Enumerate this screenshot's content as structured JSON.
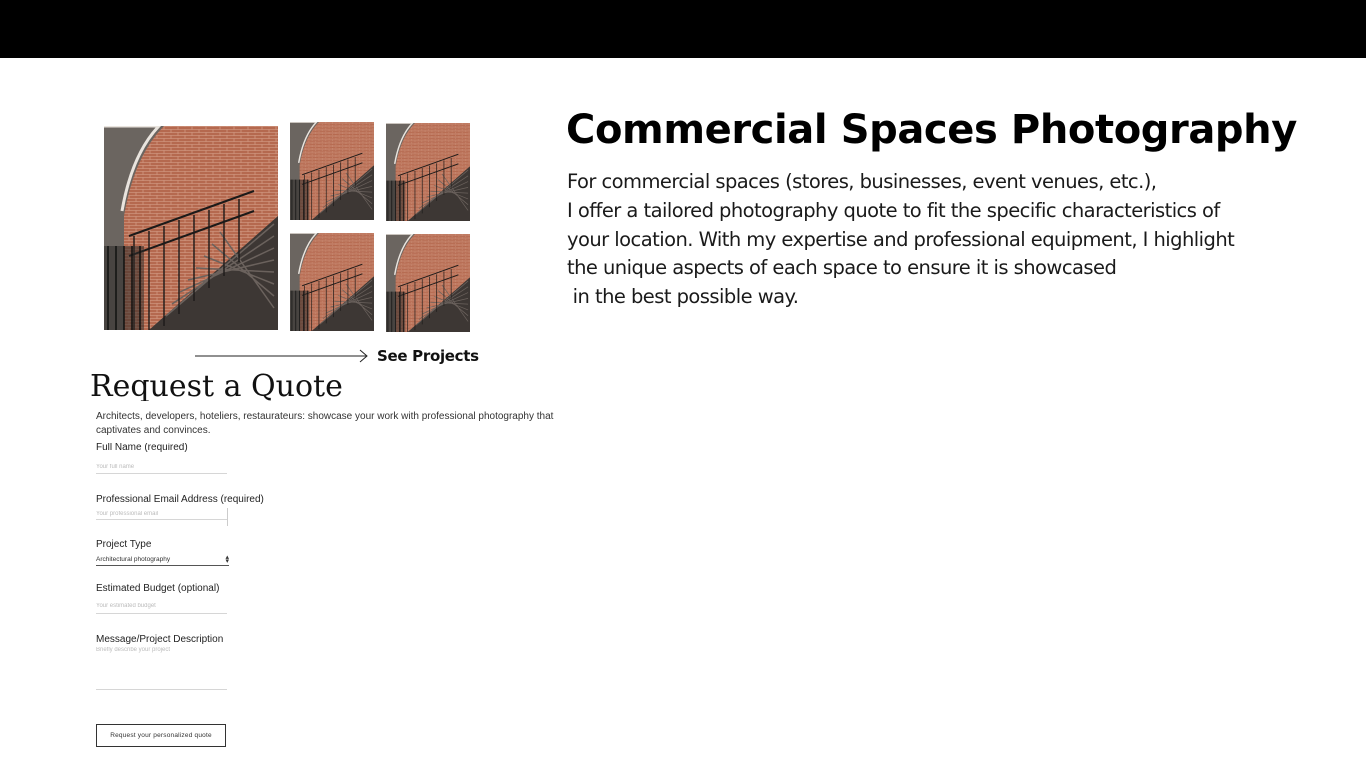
{
  "header": {},
  "hero": {
    "title": "Commercial Spaces Photography",
    "description": "For commercial spaces (stores, businesses, event venues, etc.),\nI offer a tailored photography quote to fit the specific characteristics of\nyour location. With my expertise and professional equipment, I highlight\nthe unique aspects of each space to ensure it is showcased\n in the best possible way."
  },
  "gallery": {
    "link_label": "See Projects",
    "arrow_icon": "long-arrow-right-icon"
  },
  "quote_form": {
    "title": "Request a Quote",
    "intro": "Architects, developers, hoteliers, restaurateurs: showcase your work with professional photography that captivates and convinces.",
    "fields": {
      "full_name": {
        "label": "Full Name (required)",
        "placeholder": "Your full name"
      },
      "email": {
        "label": "Professional Email Address (required)",
        "placeholder": "Your professional email"
      },
      "project_type": {
        "label": "Project Type",
        "value": "Architectural photography"
      },
      "budget": {
        "label": "Estimated Budget (optional)",
        "placeholder": "Your estimated budget"
      },
      "message": {
        "label": "Message/Project Description",
        "placeholder": "Briefly describe your project"
      }
    },
    "submit_label": "Request your personalized quote"
  },
  "colors": {
    "header_bar": "#000000",
    "brick": "#b86e55",
    "text": "#111111"
  }
}
